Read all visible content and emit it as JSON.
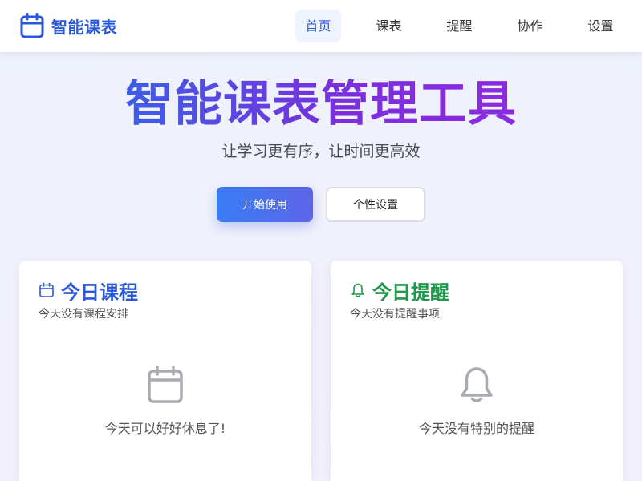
{
  "header": {
    "brand_name": "智能课表",
    "nav": [
      {
        "label": "首页",
        "active": true
      },
      {
        "label": "课表",
        "active": false
      },
      {
        "label": "提醒",
        "active": false
      },
      {
        "label": "协作",
        "active": false
      },
      {
        "label": "设置",
        "active": false
      }
    ]
  },
  "hero": {
    "title": "智能课表管理工具",
    "subtitle": "让学习更有序，让时间更高效",
    "primary_button": "开始使用",
    "secondary_button": "个性设置"
  },
  "cards": {
    "today_courses": {
      "icon": "calendar-icon",
      "title": "今日课程",
      "description": "今天没有课程安排",
      "empty_text": "今天可以好好休息了!"
    },
    "today_reminders": {
      "icon": "bell-icon",
      "title": "今日提醒",
      "description": "今天没有提醒事项",
      "empty_text": "今天没有特别的提醒"
    }
  },
  "colors": {
    "brand_blue": "#2b58d8",
    "success_green": "#1d9a4a",
    "gradient_start": "#3d5ee6",
    "gradient_end": "#8c2be0"
  }
}
